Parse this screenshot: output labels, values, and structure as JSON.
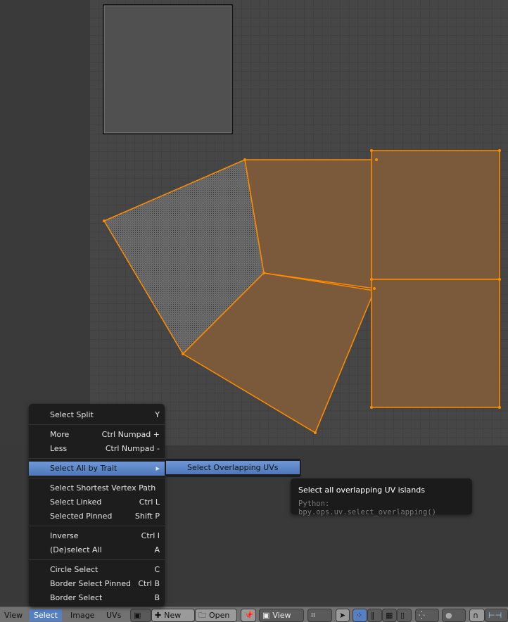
{
  "header": {
    "menus": [
      "View",
      "Select",
      "Image",
      "UVs"
    ],
    "active_menu": "Select",
    "new_label": "New",
    "open_label": "Open",
    "view_label": "View"
  },
  "select_menu": {
    "items": [
      {
        "label": "Select Split",
        "shortcut": "Y"
      },
      {
        "sep": true
      },
      {
        "label": "More",
        "shortcut": "Ctrl Numpad +"
      },
      {
        "label": "Less",
        "shortcut": "Ctrl Numpad -"
      },
      {
        "sep": true
      },
      {
        "label": "Select All by Trait",
        "shortcut": "",
        "submenu": true,
        "highlighted": true
      },
      {
        "sep": true
      },
      {
        "label": "Select Shortest Vertex Path",
        "shortcut": ""
      },
      {
        "label": "Select Linked",
        "shortcut": "Ctrl L"
      },
      {
        "label": "Selected Pinned",
        "shortcut": "Shift P"
      },
      {
        "sep": true
      },
      {
        "label": "Inverse",
        "shortcut": "Ctrl I"
      },
      {
        "label": "(De)select All",
        "shortcut": "A"
      },
      {
        "sep": true
      },
      {
        "label": "Circle Select",
        "shortcut": "C"
      },
      {
        "label": "Border Select Pinned",
        "shortcut": "Ctrl B"
      },
      {
        "label": "Border Select",
        "shortcut": "B"
      }
    ]
  },
  "submenu": {
    "label": "Select Overlapping UVs"
  },
  "tooltip": {
    "title": "Select all overlapping UV islands",
    "python": "Python: bpy.ops.uv.select_overlapping()"
  },
  "colors": {
    "selected_face": "#7a5a3a",
    "selected_edge": "#ff8c00",
    "highlight": "#5680c2"
  }
}
